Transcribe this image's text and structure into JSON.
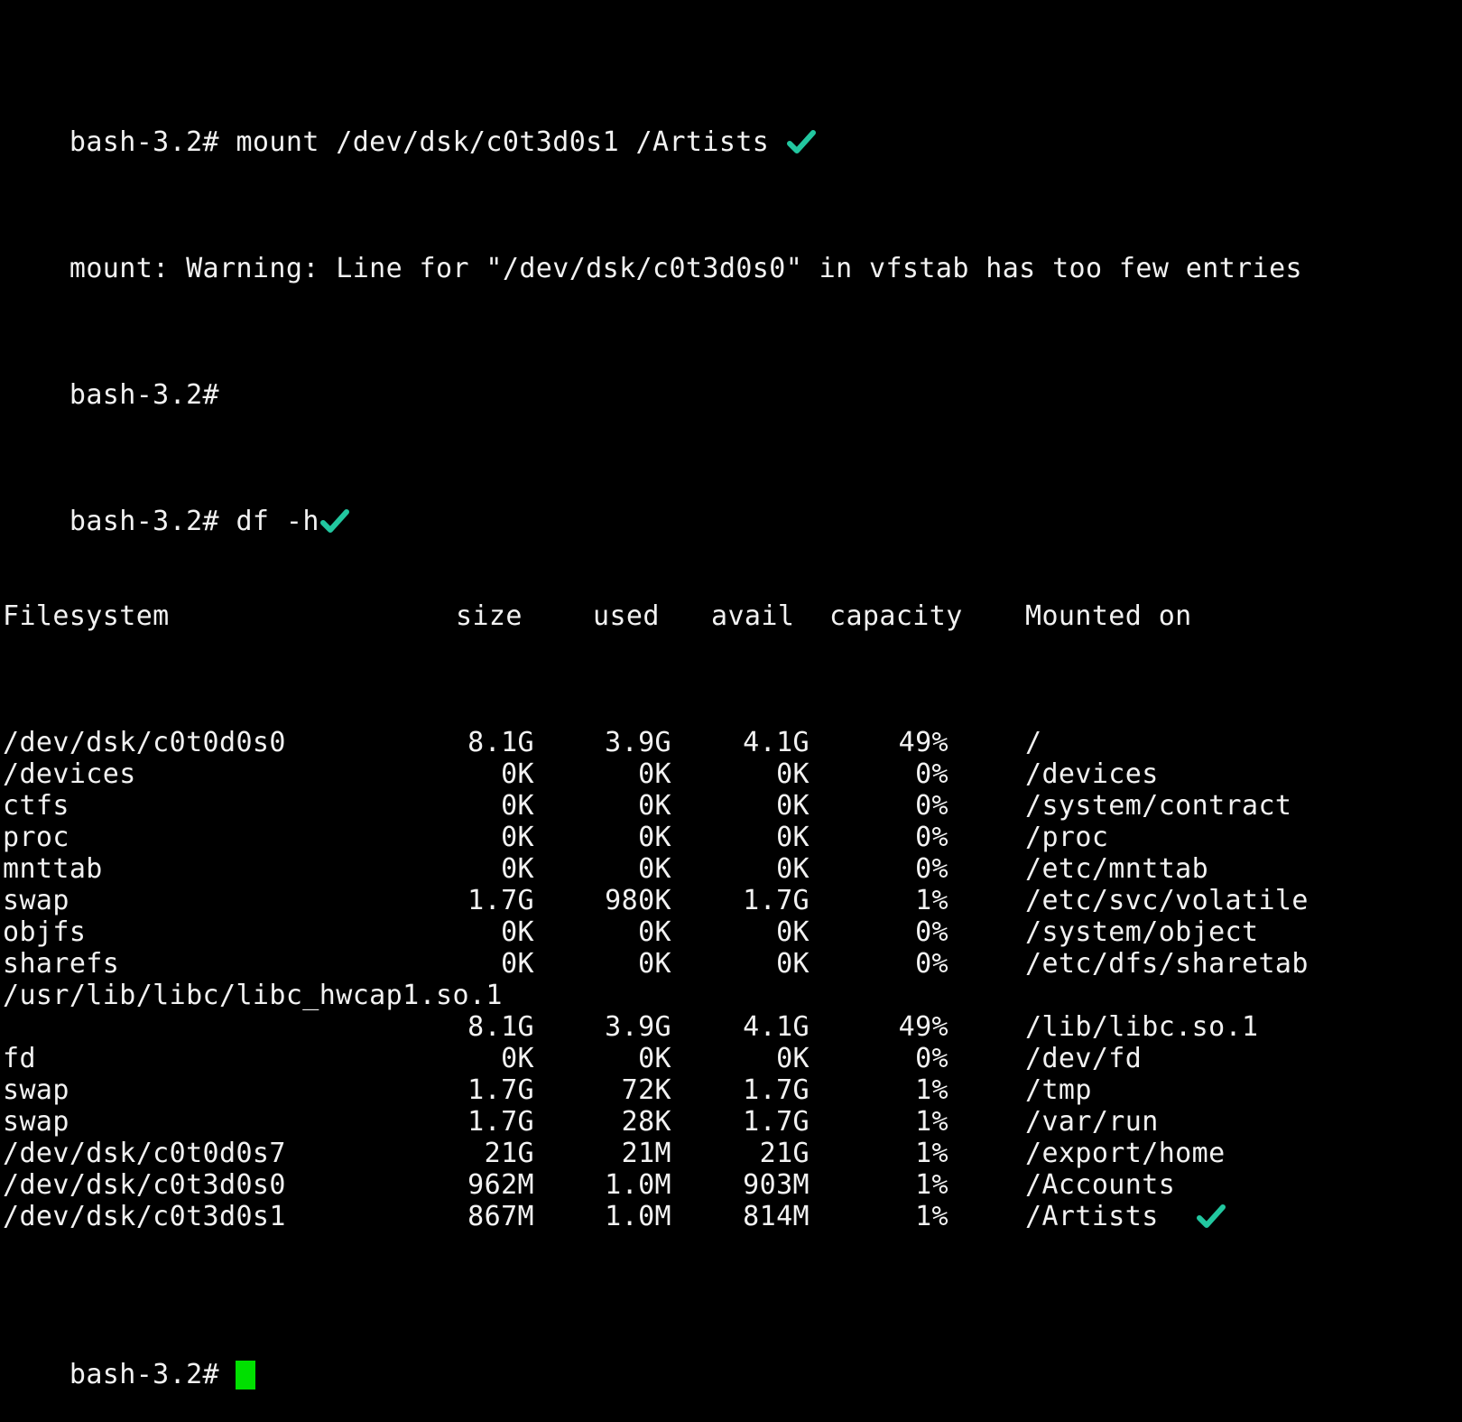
{
  "colors": {
    "background": "#000000",
    "text": "#f2f2f2",
    "check_mark": "#22c7a0",
    "cursor": "#00e000"
  },
  "terminal": {
    "lines": {
      "cmd_mount": "bash-3.2# mount /dev/dsk/c0t3d0s1 /Artists",
      "warning": "mount: Warning: Line for \"/dev/dsk/c0t3d0s0\" in vfstab has too few entries",
      "prompt_empty": "bash-3.2#",
      "cmd_df": "bash-3.2# df -h",
      "final_prompt": "bash-3.2# "
    },
    "df_header": {
      "filesystem": "Filesystem",
      "size": "size",
      "used": "used",
      "avail": "avail",
      "capacity": "capacity",
      "mounted_on": "Mounted on"
    },
    "df_rows": [
      {
        "filesystem": "/dev/dsk/c0t0d0s0",
        "size": "8.1G",
        "used": "3.9G",
        "avail": "4.1G",
        "capacity": "49%",
        "mounted_on": "/"
      },
      {
        "filesystem": "/devices",
        "size": "0K",
        "used": "0K",
        "avail": "0K",
        "capacity": "0%",
        "mounted_on": "/devices"
      },
      {
        "filesystem": "ctfs",
        "size": "0K",
        "used": "0K",
        "avail": "0K",
        "capacity": "0%",
        "mounted_on": "/system/contract"
      },
      {
        "filesystem": "proc",
        "size": "0K",
        "used": "0K",
        "avail": "0K",
        "capacity": "0%",
        "mounted_on": "/proc"
      },
      {
        "filesystem": "mnttab",
        "size": "0K",
        "used": "0K",
        "avail": "0K",
        "capacity": "0%",
        "mounted_on": "/etc/mnttab"
      },
      {
        "filesystem": "swap",
        "size": "1.7G",
        "used": "980K",
        "avail": "1.7G",
        "capacity": "1%",
        "mounted_on": "/etc/svc/volatile"
      },
      {
        "filesystem": "objfs",
        "size": "0K",
        "used": "0K",
        "avail": "0K",
        "capacity": "0%",
        "mounted_on": "/system/object"
      },
      {
        "filesystem": "sharefs",
        "size": "0K",
        "used": "0K",
        "avail": "0K",
        "capacity": "0%",
        "mounted_on": "/etc/dfs/sharetab"
      },
      {
        "filesystem": "/usr/lib/libc/libc_hwcap1.so.1",
        "size": "",
        "used": "",
        "avail": "",
        "capacity": "",
        "mounted_on": ""
      },
      {
        "filesystem": "",
        "size": "8.1G",
        "used": "3.9G",
        "avail": "4.1G",
        "capacity": "49%",
        "mounted_on": "/lib/libc.so.1"
      },
      {
        "filesystem": "fd",
        "size": "0K",
        "used": "0K",
        "avail": "0K",
        "capacity": "0%",
        "mounted_on": "/dev/fd"
      },
      {
        "filesystem": "swap",
        "size": "1.7G",
        "used": "72K",
        "avail": "1.7G",
        "capacity": "1%",
        "mounted_on": "/tmp"
      },
      {
        "filesystem": "swap",
        "size": "1.7G",
        "used": "28K",
        "avail": "1.7G",
        "capacity": "1%",
        "mounted_on": "/var/run"
      },
      {
        "filesystem": "/dev/dsk/c0t0d0s7",
        "size": "21G",
        "used": "21M",
        "avail": "21G",
        "capacity": "1%",
        "mounted_on": "/export/home"
      },
      {
        "filesystem": "/dev/dsk/c0t3d0s0",
        "size": "962M",
        "used": "1.0M",
        "avail": "903M",
        "capacity": "1%",
        "mounted_on": "/Accounts"
      },
      {
        "filesystem": "/dev/dsk/c0t3d0s1",
        "size": "867M",
        "used": "1.0M",
        "avail": "814M",
        "capacity": "1%",
        "mounted_on": "/Artists"
      }
    ]
  },
  "icons": {
    "check": "check-mark-icon",
    "cursor": "block-cursor"
  }
}
